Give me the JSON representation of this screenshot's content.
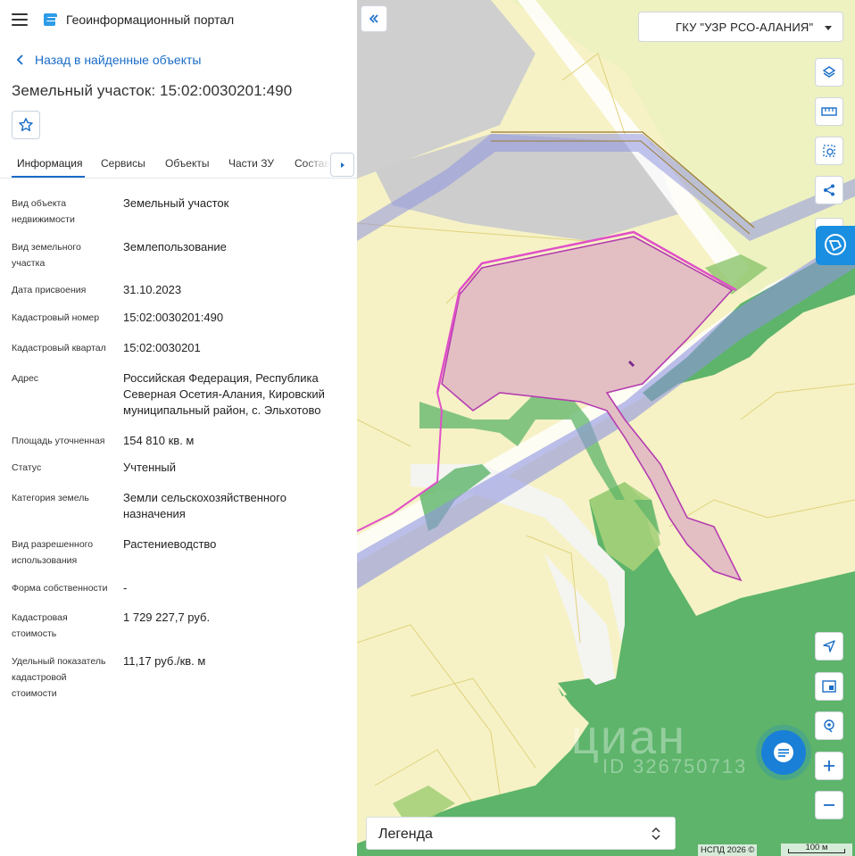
{
  "app": {
    "title": "Геоинформационный портал"
  },
  "nav": {
    "back_label": "Назад в найденные объекты"
  },
  "object": {
    "title": "Земельный участок: 15:02:0030201:490"
  },
  "tabs": [
    {
      "label": "Информация",
      "active": true
    },
    {
      "label": "Сервисы",
      "active": false
    },
    {
      "label": "Объекты",
      "active": false
    },
    {
      "label": "Части ЗУ",
      "active": false
    },
    {
      "label": "Состав",
      "active": false
    }
  ],
  "properties": [
    {
      "key": "Вид объекта недвижимости",
      "value": "Земельный участок"
    },
    {
      "key": "Вид земельного участка",
      "value": "Землепользование"
    },
    {
      "key": "Дата присвоения",
      "value": "31.10.2023"
    },
    {
      "key": "Кадастровый номер",
      "value": "15:02:0030201:490"
    },
    {
      "key": "Кадастровый квартал",
      "value": "15:02:0030201"
    },
    {
      "key": "Адрес",
      "value": "Российская Федерация, Республика Северная Осетия-Алания, Кировский муниципальный район, с. Эльхотово"
    },
    {
      "key": "Площадь уточненная",
      "value": "154 810 кв. м"
    },
    {
      "key": "Статус",
      "value": "Учтенный"
    },
    {
      "key": "Категория земель",
      "value": "Земли сельскохозяйственного назначения"
    },
    {
      "key": "Вид разрешенного использования",
      "value": "Растениеводство"
    },
    {
      "key": "Форма собственности",
      "value": "-"
    },
    {
      "key": "Кадастровая стоимость",
      "value": "1 729 227,7 руб."
    },
    {
      "key": "Удельный показатель кадастровой стоимости",
      "value": "11,17 руб./кв. м"
    }
  ],
  "map": {
    "organization": "ГКУ \"УЗР РСО-АЛАНИЯ\"",
    "legend_label": "Легенда",
    "attribution": "НСПД 2026 ©",
    "scale_label": "100 м",
    "watermark": "циан",
    "watermark_id": "ID 326750713",
    "colors": {
      "background": "#f6f2c6",
      "forest": "#5db46a",
      "parcel_fill": "#e3bfc4",
      "parcel_stroke": "#b53db0",
      "road_band": "#8f95e0",
      "built_area": "#c9c9c9",
      "accent": "#1a7fd6"
    },
    "tools": [
      "layers-icon",
      "ruler-icon",
      "select-area-icon",
      "share-icon",
      "locate-icon",
      "minimap-icon",
      "geotag-icon",
      "zoom-in-icon",
      "zoom-out-icon"
    ]
  }
}
